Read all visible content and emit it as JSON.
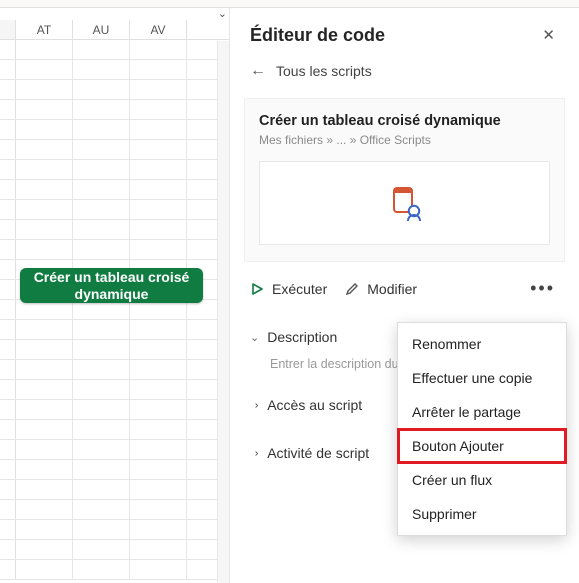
{
  "sheet": {
    "columns": [
      "AT",
      "AU",
      "AV"
    ],
    "button_label": "Créer un tableau croisé dynamique"
  },
  "panel": {
    "title": "Éditeur de code",
    "back_label": "Tous les scripts",
    "script_title": "Créer un tableau croisé dynamique",
    "breadcrumb": "Mes fichiers » ... » Office Scripts",
    "run_label": "Exécuter",
    "edit_label": "Modifier",
    "sections": {
      "description": {
        "label": "Description",
        "placeholder": "Entrer la description du script"
      },
      "access": {
        "label": "Accès au script"
      },
      "activity": {
        "label": "Activité de script"
      }
    }
  },
  "menu": {
    "rename": "Renommer",
    "copy": "Effectuer une copie",
    "stop_share": "Arrêter le partage",
    "add_button": "Bouton Ajouter",
    "create_flow": "Créer un flux",
    "delete": "Supprimer"
  },
  "colors": {
    "brand_green": "#107c41",
    "accent_orange": "#d65532"
  }
}
